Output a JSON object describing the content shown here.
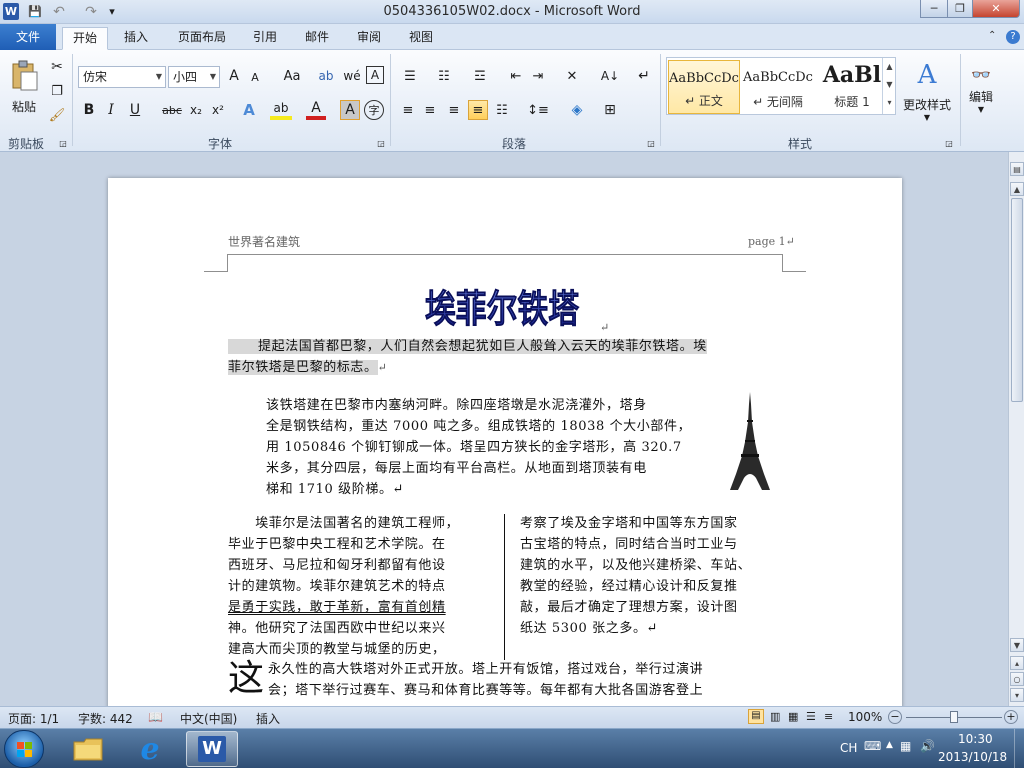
{
  "window": {
    "title": "0504336105W02.docx - Microsoft Word",
    "app_icon": "W",
    "min_symbol": "─",
    "max_symbol": "❐",
    "close_symbol": "✕"
  },
  "quick_access": {
    "save_icon": "💾",
    "undo_icon": "↶",
    "redo_icon": "↷",
    "customize_icon": "▾"
  },
  "tabs": [
    {
      "label": "文件"
    },
    {
      "label": "开始"
    },
    {
      "label": "插入"
    },
    {
      "label": "页面布局"
    },
    {
      "label": "引用"
    },
    {
      "label": "邮件"
    },
    {
      "label": "审阅"
    },
    {
      "label": "视图"
    }
  ],
  "ribbon": {
    "clipboard": {
      "group_label": "剪贴板",
      "paste_label": "粘贴"
    },
    "font": {
      "group_label": "字体",
      "font_name": "仿宋",
      "font_size": "小四",
      "grow_label": "A",
      "shrink_label": "A",
      "case_label": "Aa",
      "bold_label": "B",
      "italic_label": "I",
      "underline_label": "U",
      "strike_label": "abc",
      "sub_label": "x₂",
      "sup_label": "x²"
    },
    "paragraph": {
      "group_label": "段落"
    },
    "styles": {
      "group_label": "样式",
      "items": [
        {
          "preview": "AaBbCcDc",
          "name": "↵ 正文"
        },
        {
          "preview": "AaBbCcDc",
          "name": "↵ 无间隔"
        },
        {
          "preview": "AaBl",
          "name": "标题 1"
        }
      ],
      "change_styles_label": "更改样式"
    },
    "editing": {
      "label": "编辑"
    }
  },
  "document": {
    "header_left": "世界著名建筑",
    "header_right": "page 1↵",
    "wordart_title": "埃菲尔铁塔",
    "p1_line1": "提起法国首都巴黎，人们自然会想起犹如巨人般耸入云天的埃菲尔铁塔。埃",
    "p1_line2": "菲尔铁塔是巴黎的标志。",
    "p2_lines": [
      "该铁塔建在巴黎市内塞纳河畔。除四座塔墩是水泥浇灌外，塔身",
      "全是钢铁结构，重达 7000 吨之多。组成铁塔的 18038 个大小部件，",
      "用 1050846 个铆钉铆成一体。塔呈四方狭长的金字塔形，高 320.7",
      "米多，其分四层，每层上面均有平台高栏。从地面到塔顶装有电",
      "梯和 1710 级阶梯。↵"
    ],
    "col1_lines": [
      "　　埃菲尔是法国著名的建筑工程师，",
      "毕业于巴黎中央工程和艺术学院。在",
      "西班牙、马尼拉和匈牙利都留有他设",
      "计的建筑物。埃菲尔建筑艺术的特点",
      "是勇于实践，敢于革新，富有首创精",
      "神。他研究了法国西欧中世纪以来兴",
      "建高大而尖顶的教堂与城堡的历史，"
    ],
    "col2_lines": [
      "考察了埃及金字塔和中国等东方国家",
      "古宝塔的特点，同时结合当时工业与",
      "建筑的水平，以及他兴建桥梁、车站、",
      "教堂的经验，经过精心设计和反复推",
      "敲，最后才确定了理想方案，设计图",
      "纸达 5300 张之多。↵"
    ],
    "dropcap": "这",
    "p4_line1": "永久性的高大铁塔对外正式开放。塔上开有饭馆，搭过戏台，举行过演讲",
    "p4_line2": "会；塔下举行过赛车、赛马和体育比赛等等。每年都有大批各国游客登上"
  },
  "status": {
    "page": "页面: 1/1",
    "words": "字数: 442",
    "language": "中文(中国)",
    "mode": "插入",
    "zoom": "100%",
    "zoom_minus": "−",
    "zoom_plus": "+"
  },
  "taskbar": {
    "ime": "CH",
    "time": "10:30",
    "date": "2013/10/18"
  }
}
